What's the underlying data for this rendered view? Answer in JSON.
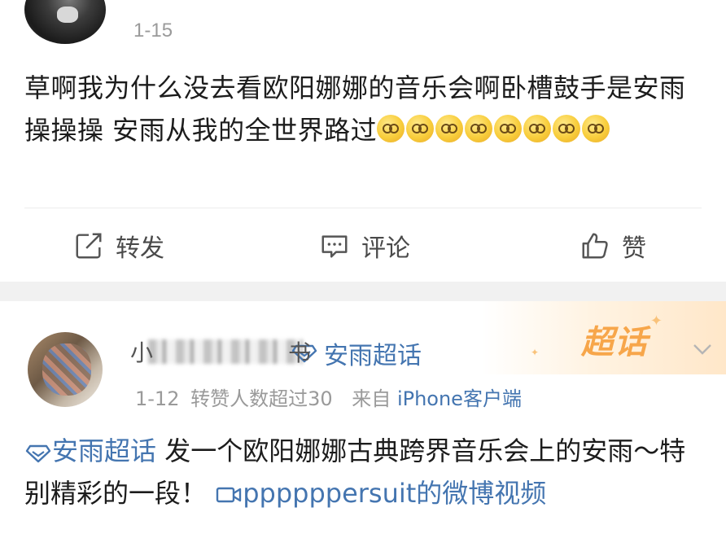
{
  "post1": {
    "date": "1-15",
    "text": "草啊我为什么没去看欧阳娜娜的音乐会啊卧槽鼓手是安雨操操操 安雨从我的全世界路过",
    "emoji_count": 8,
    "emoji_name": "doge-face",
    "actions": {
      "repost": "转发",
      "comment": "评论",
      "like": "赞"
    }
  },
  "post2": {
    "banner": "超话",
    "name_partial": "小",
    "name_tail": "书",
    "topic": "安雨超话",
    "meta": {
      "date": "1-12",
      "badge": "转赞人数超过30",
      "source_prefix": "来自",
      "source": "iPhone客户端"
    },
    "text_topic": "安雨超话",
    "text": " 发一个欧阳娜娜古典跨界音乐会上的安雨～特别精彩的一段！ ",
    "video_link": "ppppppersuit的微博视频"
  },
  "colors": {
    "link": "#4475b0",
    "meta": "#9a9a9a",
    "banner": "#f7a64a",
    "separator": "#f1f1f1"
  }
}
